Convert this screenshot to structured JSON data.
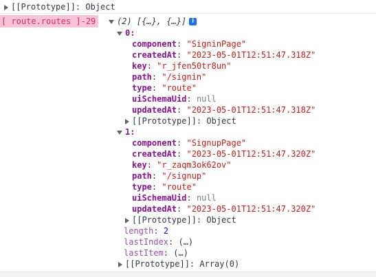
{
  "top_proto": {
    "label": "[[Prototype]]",
    "value": "Object"
  },
  "log_label": "[ route.routes ]-29",
  "array_summary": "(2) [{…}, {…}]",
  "info_icon_glyph": "i",
  "item0": {
    "index": "0",
    "component": {
      "key": "component",
      "value": "\"SigninPage\""
    },
    "createdAt": {
      "key": "createdAt",
      "value": "\"2023-05-01T12:51:47.318Z\""
    },
    "key": {
      "key": "key",
      "value": "\"r_jfen50tr8un\""
    },
    "path": {
      "key": "path",
      "value": "\"/signin\""
    },
    "type": {
      "key": "type",
      "value": "\"route\""
    },
    "uiSchemaUid": {
      "key": "uiSchemaUid",
      "value": "null"
    },
    "updatedAt": {
      "key": "updatedAt",
      "value": "\"2023-05-01T12:51:47.318Z\""
    },
    "proto": {
      "label": "[[Prototype]]",
      "value": "Object"
    }
  },
  "item1": {
    "index": "1",
    "component": {
      "key": "component",
      "value": "\"SignupPage\""
    },
    "createdAt": {
      "key": "createdAt",
      "value": "\"2023-05-01T12:51:47.320Z\""
    },
    "key": {
      "key": "key",
      "value": "\"r_zaqm3ok62ov\""
    },
    "path": {
      "key": "path",
      "value": "\"/signup\""
    },
    "type": {
      "key": "type",
      "value": "\"route\""
    },
    "uiSchemaUid": {
      "key": "uiSchemaUid",
      "value": "null"
    },
    "updatedAt": {
      "key": "updatedAt",
      "value": "\"2023-05-01T12:51:47.320Z\""
    },
    "proto": {
      "label": "[[Prototype]]",
      "value": "Object"
    }
  },
  "length": {
    "key": "length",
    "value": "2"
  },
  "lastIndex": {
    "key": "lastIndex",
    "value": "(…)"
  },
  "lastItem": {
    "key": "lastItem",
    "value": "(…)"
  },
  "array_proto": {
    "label": "[[Prototype]]",
    "value": "Array(0)"
  }
}
